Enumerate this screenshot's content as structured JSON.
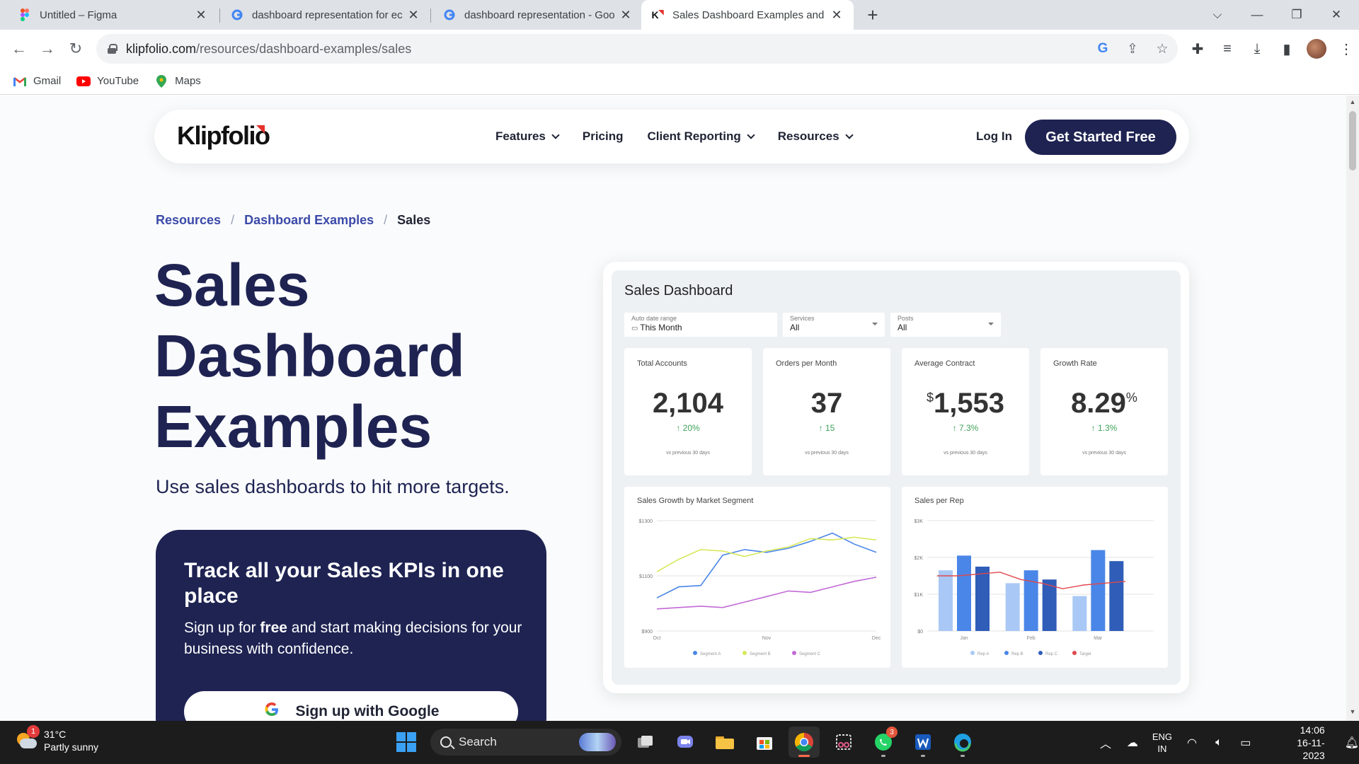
{
  "browser": {
    "tabs": [
      {
        "title": "Untitled – Figma",
        "favicon": "figma-icon"
      },
      {
        "title": "dashboard representation for ec",
        "favicon": "google-icon"
      },
      {
        "title": "dashboard representation - Goo",
        "favicon": "google-icon"
      },
      {
        "title": "Sales Dashboard Examples and",
        "favicon": "klipfolio-icon"
      }
    ],
    "new_tab": "+",
    "url_host": "klipfolio.com",
    "url_path": "/resources/dashboard-examples/sales",
    "bookmarks": [
      "Gmail",
      "YouTube",
      "Maps"
    ]
  },
  "site": {
    "logo": "Klipfolio",
    "menu": [
      "Features",
      "Pricing",
      "Client Reporting",
      "Resources"
    ],
    "login": "Log In",
    "cta": "Get Started Free"
  },
  "breadcrumb": {
    "items": [
      "Resources",
      "Dashboard Examples"
    ],
    "sep": "/",
    "current": "Sales"
  },
  "hero": {
    "title": "Sales Dashboard Examples",
    "subtitle": "Use sales dashboards to hit more targets."
  },
  "promo": {
    "title": "Track all your Sales KPIs in one place",
    "text_before": "Sign up for ",
    "text_bold": "free",
    "text_after": " and start making decisions for your business with confidence.",
    "google_button": "Sign up with Google"
  },
  "dashboard": {
    "title": "Sales Dashboard",
    "filters": [
      {
        "label": "Auto date range",
        "value": "This Month"
      },
      {
        "label": "Services",
        "value": "All"
      },
      {
        "label": "Posts",
        "value": "All"
      }
    ],
    "kpis": [
      {
        "label": "Total Accounts",
        "prefix": "",
        "value": "2,104",
        "suffix": "",
        "delta": "↑ 20%",
        "foot": "vs previous 30 days"
      },
      {
        "label": "Orders per Month",
        "prefix": "",
        "value": "37",
        "suffix": "",
        "delta": "↑ 15",
        "foot": "vs previous 30 days"
      },
      {
        "label": "Average Contract",
        "prefix": "$",
        "value": "1,553",
        "suffix": "",
        "delta": "↑ 7.3%",
        "foot": "vs previous 30 days"
      },
      {
        "label": "Growth Rate",
        "prefix": "",
        "value": "8.29",
        "suffix": "%",
        "delta": "↑ 1.3%",
        "foot": "vs previous 30 days"
      }
    ],
    "colors": {
      "green": "#3ea35a",
      "segA": "#4a86e8",
      "segB": "#d7e85a",
      "segC": "#c26ad6",
      "repA": "#a9c8f5",
      "repB": "#4a86e8",
      "repC": "#2f5db8",
      "target": "#e0474c"
    }
  },
  "chart_data": [
    {
      "type": "line",
      "title": "Sales Growth by Market Segment",
      "categories": [
        "Oct",
        "Nov",
        "Dec"
      ],
      "x": [
        0,
        1,
        2,
        3,
        4,
        5,
        6,
        7,
        8,
        9,
        10
      ],
      "ylim": [
        900,
        1300
      ],
      "yticks": [
        "$1300",
        "$1100",
        "$900"
      ],
      "series": [
        {
          "name": "Segment A",
          "values": [
            1020,
            1060,
            1065,
            1175,
            1195,
            1185,
            1200,
            1225,
            1255,
            1215,
            1185
          ]
        },
        {
          "name": "Segment B",
          "values": [
            1115,
            1160,
            1195,
            1190,
            1170,
            1190,
            1205,
            1235,
            1230,
            1240,
            1230
          ]
        },
        {
          "name": "Segment C",
          "values": [
            980,
            985,
            990,
            985,
            1005,
            1025,
            1045,
            1040,
            1060,
            1080,
            1095
          ]
        }
      ],
      "legend": "bottom"
    },
    {
      "type": "bar",
      "title": "Sales per Rep",
      "categories": [
        "Jan",
        "Feb",
        "Mar"
      ],
      "ylim": [
        0,
        3000
      ],
      "yticks": [
        "$3K",
        "$2K",
        "$1K",
        "$0"
      ],
      "series": [
        {
          "name": "Rep A",
          "values": [
            1650,
            1300,
            950
          ]
        },
        {
          "name": "Rep B",
          "values": [
            2050,
            1650,
            2200
          ]
        },
        {
          "name": "Rep C",
          "values": [
            1750,
            1400,
            1900
          ]
        }
      ],
      "target": {
        "name": "Target",
        "values": [
          1500,
          1500,
          1550,
          1600,
          1400,
          1300,
          1150,
          1250,
          1300,
          1350
        ]
      },
      "legend": "bottom"
    }
  ],
  "taskbar": {
    "temp": "31°C",
    "weather": "Partly sunny",
    "weather_badge": "1",
    "search": "Search",
    "whatsapp_badge": "3",
    "lang1": "ENG",
    "lang2": "IN",
    "time": "14:06",
    "date": "16-11-2023"
  }
}
